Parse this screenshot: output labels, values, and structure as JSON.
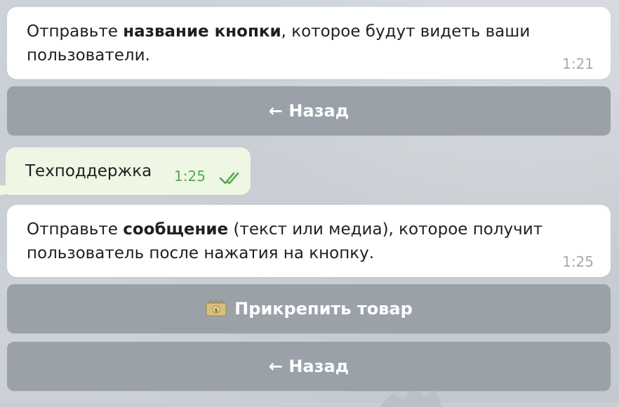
{
  "messages": [
    {
      "type": "incoming",
      "text_before": "Отправьте ",
      "text_bold": "название кнопки",
      "text_after": ", которое будут видеть ваши пользователи.",
      "time": "1:21"
    },
    {
      "type": "outgoing",
      "text": "Техподдержка",
      "time": "1:25",
      "status_icon": "double-check-icon"
    },
    {
      "type": "incoming",
      "text_before": "Отправьте ",
      "text_bold": "сообщение",
      "text_after": " (текст или медиа), которое получит пользователь после нажатия на кнопку.",
      "time": "1:25"
    }
  ],
  "keyboard": {
    "back_1": "← Назад",
    "attach_icon": "money-bag-icon",
    "attach_label": "Прикрепить товар",
    "back_2": "← Назад"
  },
  "colors": {
    "background": "#c9ced4",
    "incoming_bubble": "#ffffff",
    "outgoing_bubble": "#eef7e3",
    "button": "#9aa1a9",
    "outgoing_time": "#5ba655",
    "incoming_time": "#a6abb0"
  }
}
